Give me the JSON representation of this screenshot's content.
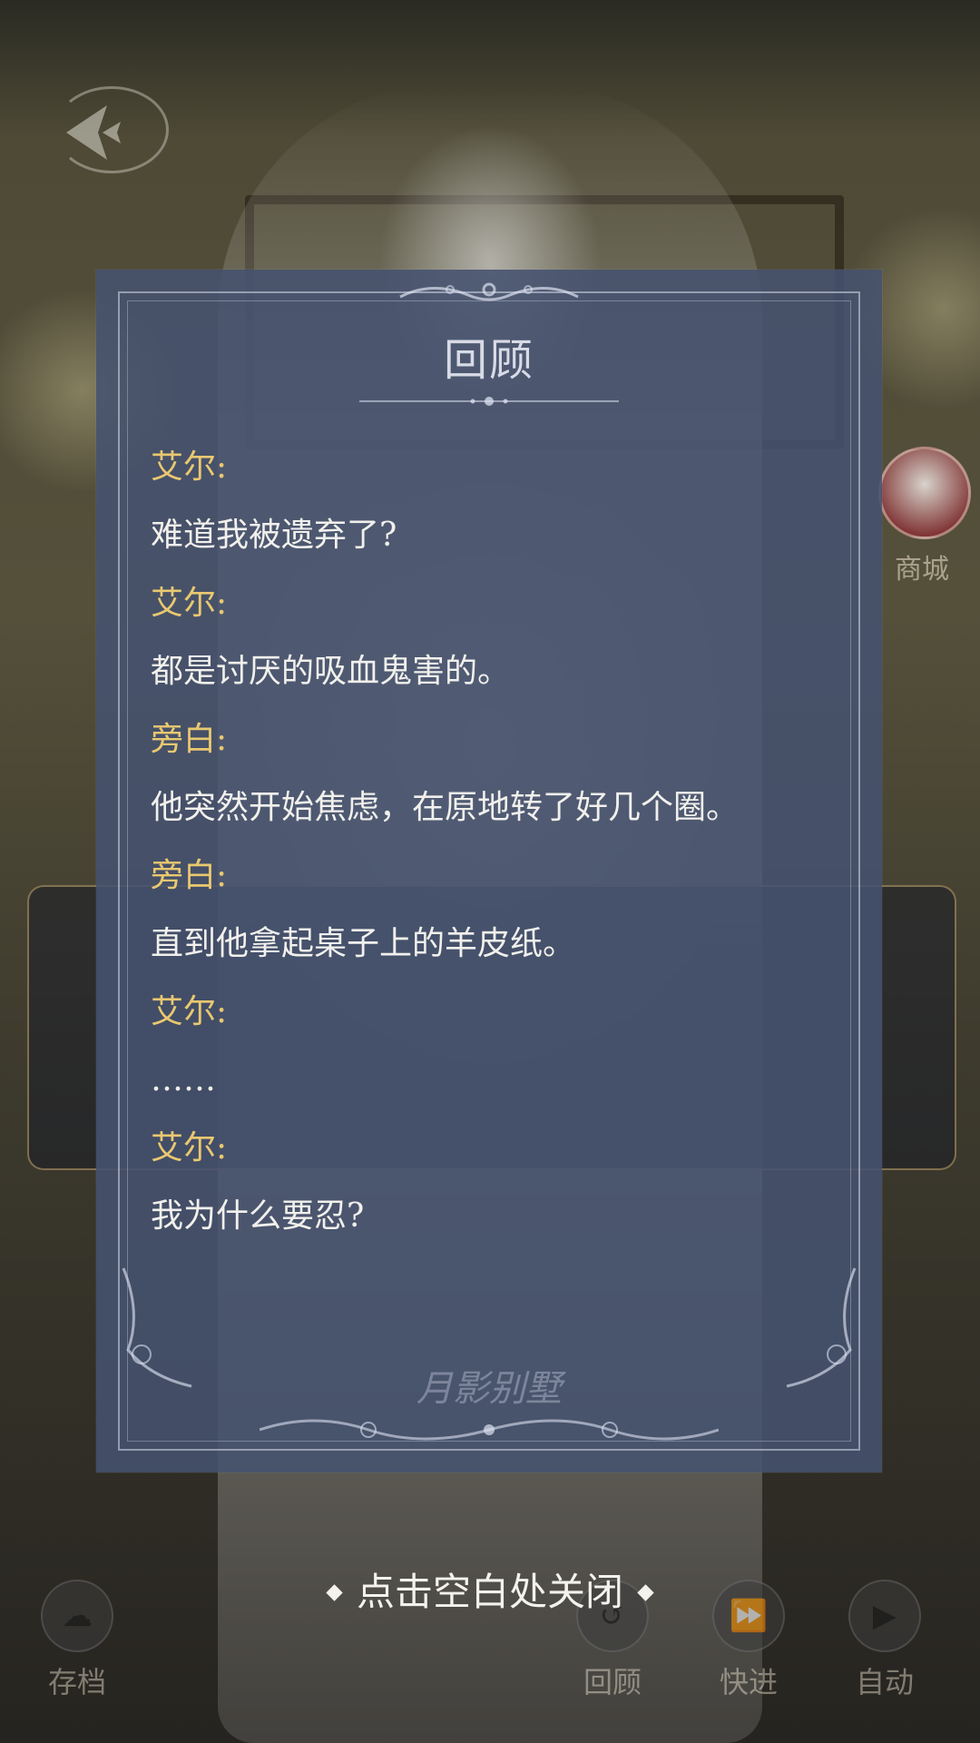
{
  "review": {
    "title": "回顾",
    "entries": [
      {
        "speaker": "艾尔:",
        "text": "难道我被遗弃了?"
      },
      {
        "speaker": "艾尔:",
        "text": "都是讨厌的吸血鬼害的。"
      },
      {
        "speaker": "旁白:",
        "text": "他突然开始焦虑，在原地转了好几个圈。"
      },
      {
        "speaker": "旁白:",
        "text": "直到他拿起桌子上的羊皮纸。"
      },
      {
        "speaker": "艾尔:",
        "text": "……"
      },
      {
        "speaker": "艾尔:",
        "text": "我为什么要忍?"
      }
    ],
    "watermark": "月影别墅"
  },
  "close_hint": "点击空白处关闭",
  "background": {
    "shop_label": "商城",
    "controls": {
      "save": "存档",
      "review": "回顾",
      "fast_forward": "快进",
      "auto": "自动"
    }
  },
  "colors": {
    "speaker": "#e9c870",
    "text": "#f1f0ec",
    "panel": "#465270"
  }
}
